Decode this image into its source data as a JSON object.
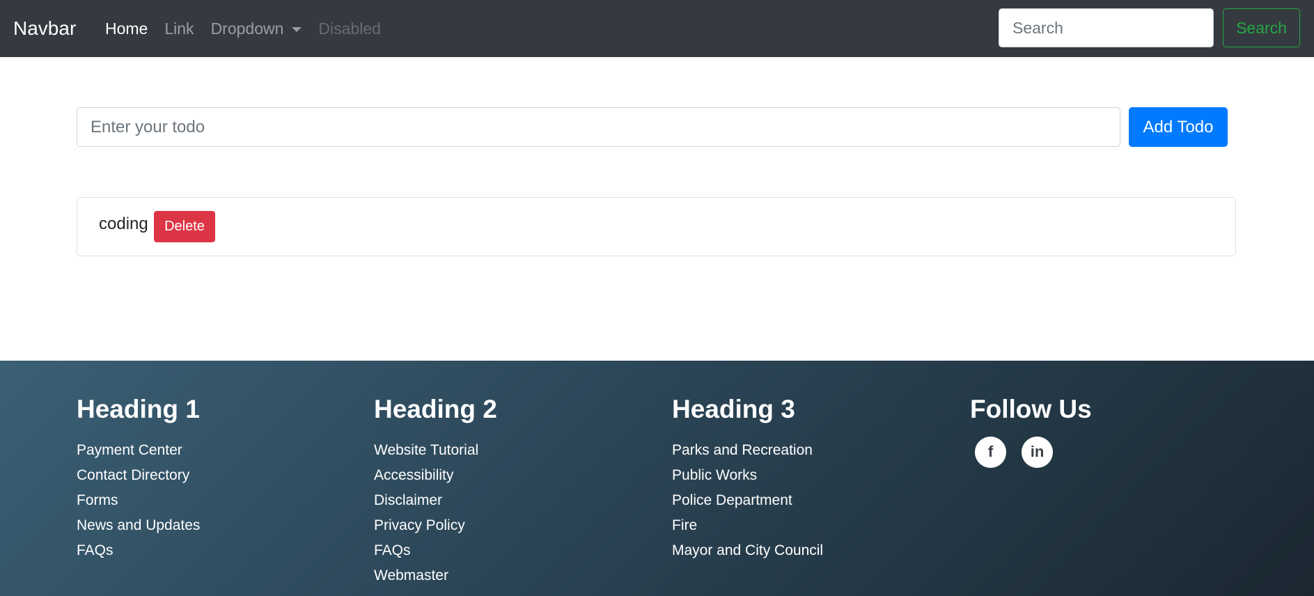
{
  "navbar": {
    "brand": "Navbar",
    "links": [
      {
        "label": "Home"
      },
      {
        "label": "Link"
      },
      {
        "label": "Dropdown"
      },
      {
        "label": "Disabled"
      }
    ],
    "search_placeholder": "Search",
    "search_button": "Search"
  },
  "todo": {
    "input_placeholder": "Enter your todo",
    "add_button": "Add Todo",
    "items": [
      {
        "text": "coding",
        "delete_label": "Delete"
      }
    ]
  },
  "footer": {
    "columns": [
      {
        "heading": "Heading 1",
        "links": [
          "Payment Center",
          "Contact Directory",
          "Forms",
          "News and Updates",
          "FAQs"
        ]
      },
      {
        "heading": "Heading 2",
        "links": [
          "Website Tutorial",
          "Accessibility",
          "Disclaimer",
          "Privacy Policy",
          "FAQs",
          "Webmaster"
        ]
      },
      {
        "heading": "Heading 3",
        "links": [
          "Parks and Recreation",
          "Public Works",
          "Police Department",
          "Fire",
          "Mayor and City Council"
        ]
      }
    ],
    "follow": {
      "heading": "Follow Us",
      "icons": [
        {
          "name": "facebook-icon",
          "glyph": "f"
        },
        {
          "name": "linkedin-icon",
          "glyph": "in"
        }
      ]
    }
  },
  "colors": {
    "navbar_bg": "#343a40",
    "primary": "#007bff",
    "danger": "#dc3545",
    "success": "#28a745"
  }
}
